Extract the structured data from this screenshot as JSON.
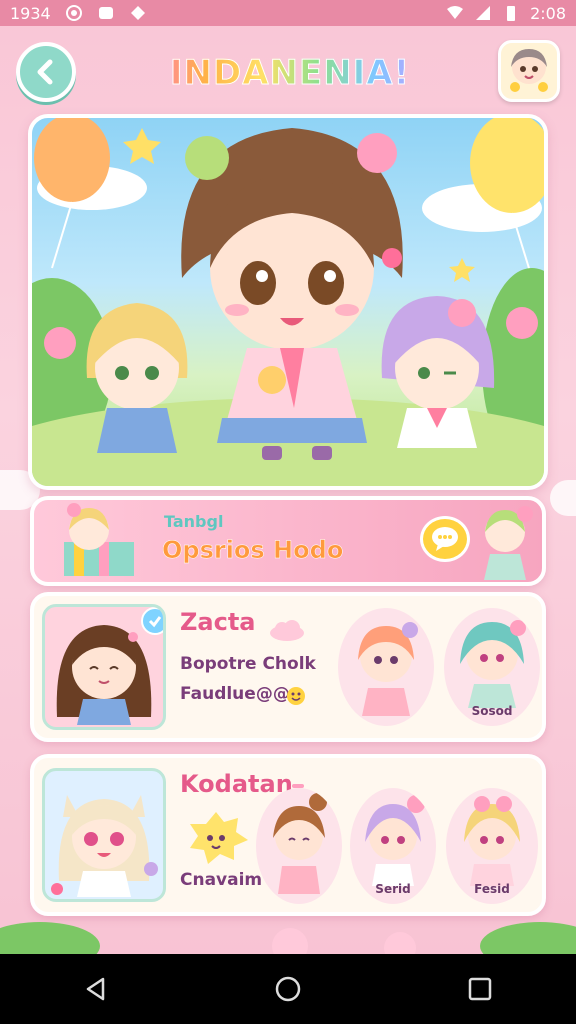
{
  "status_bar": {
    "time_left": "1934",
    "time_right": "2:08"
  },
  "header": {
    "title": "INDANENIA!",
    "back_icon": "chevron-left-icon",
    "avatar_icon": "profile-avatar"
  },
  "mode_banner": {
    "small_label": "Tanbgl",
    "big_label": "Opsrios Hodo",
    "chat_icon": "speech-bubble-icon"
  },
  "card1": {
    "title": "Zacta",
    "line1": "Bopotre Cholk",
    "line2": "Faudlue@@",
    "mini_label": "Sosod"
  },
  "card2": {
    "title": "Kodatan",
    "line1": "Cnavaim",
    "mini_labels": [
      "Serid",
      "Fesid"
    ]
  },
  "nav": {
    "back": "back-triangle-icon",
    "home": "home-circle-icon",
    "recents": "recents-square-icon"
  },
  "colors": {
    "accent_pink": "#e88aa5",
    "teal": "#8fd9c9",
    "title_text": "#e55a8a",
    "mode_orange": "#ff9a3c"
  }
}
